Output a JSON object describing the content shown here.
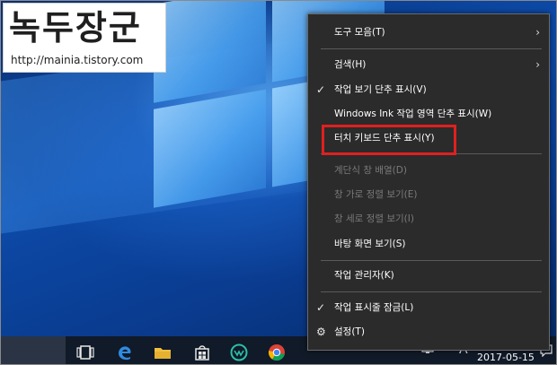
{
  "watermark": {
    "title": "녹두장군",
    "url": "http://mainia.tistory.com"
  },
  "context_menu": {
    "items": [
      {
        "label": "도구 모음(T)",
        "has_submenu": true,
        "checked": false,
        "enabled": true
      },
      {
        "label": "검색(H)",
        "has_submenu": true,
        "checked": false,
        "enabled": true
      },
      {
        "label": "작업 보기 단추 표시(V)",
        "has_submenu": false,
        "checked": true,
        "enabled": true
      },
      {
        "label": "Windows Ink 작업 영역 단추 표시(W)",
        "has_submenu": false,
        "checked": false,
        "enabled": true
      },
      {
        "label": "터치 키보드 단추 표시(Y)",
        "has_submenu": false,
        "checked": false,
        "enabled": true,
        "highlighted": true
      },
      {
        "label": "계단식 창 배열(D)",
        "has_submenu": false,
        "checked": false,
        "enabled": false
      },
      {
        "label": "창 가로 정렬 보기(E)",
        "has_submenu": false,
        "checked": false,
        "enabled": false
      },
      {
        "label": "창 세로 정렬 보기(I)",
        "has_submenu": false,
        "checked": false,
        "enabled": false
      },
      {
        "label": "바탕 화면 보기(S)",
        "has_submenu": false,
        "checked": false,
        "enabled": true
      },
      {
        "label": "작업 관리자(K)",
        "has_submenu": false,
        "checked": false,
        "enabled": true
      },
      {
        "label": "작업 표시줄 잠금(L)",
        "has_submenu": false,
        "checked": true,
        "enabled": true
      },
      {
        "label": "설정(T)",
        "has_submenu": false,
        "checked": false,
        "enabled": true,
        "icon": "gear-icon"
      }
    ],
    "highlight_color": "#e02020"
  },
  "taskbar": {
    "icons": [
      "task-view-icon",
      "edge-icon",
      "file-explorer-icon",
      "store-icon",
      "app-icon",
      "chrome-icon"
    ],
    "tray": {
      "input_indicator": "A",
      "date": "2017-05-15"
    }
  }
}
